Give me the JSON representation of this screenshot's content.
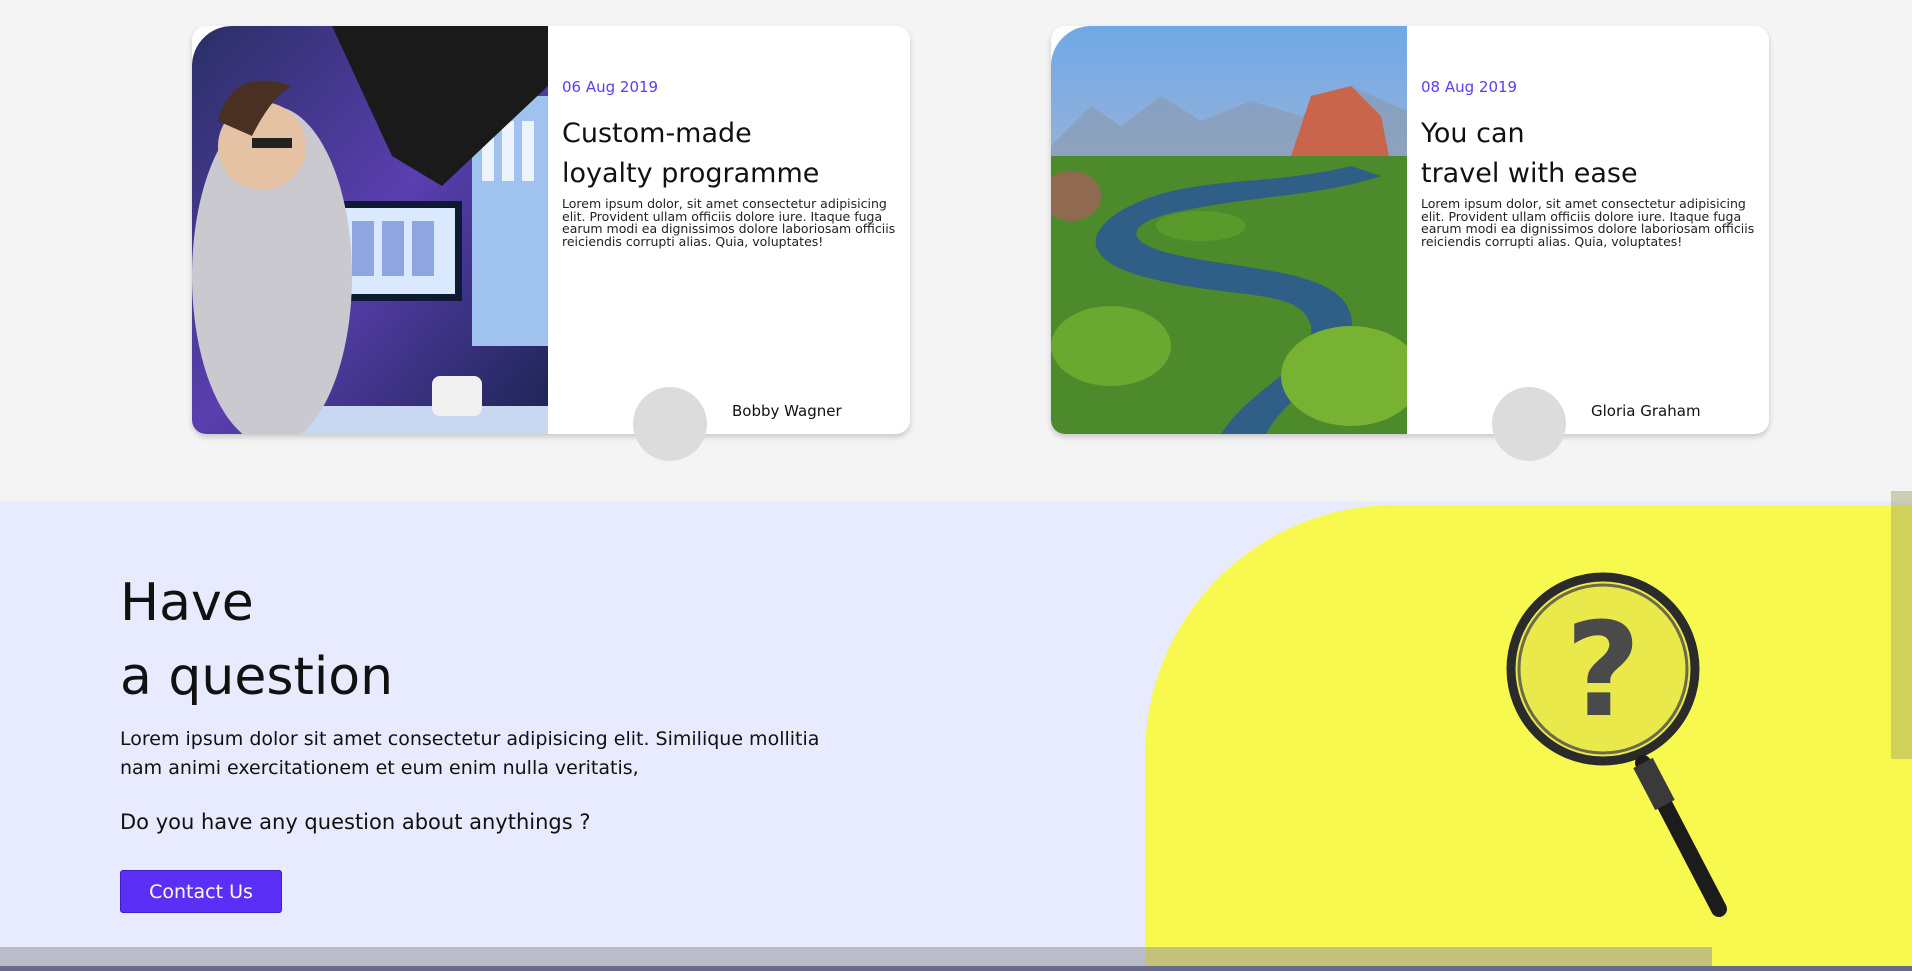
{
  "cards": [
    {
      "date": "06 Aug 2019",
      "title_line1": "Custom-made",
      "title_line2": "loyalty programme",
      "body": "Lorem ipsum dolor, sit amet consectetur adipisicing elit. Provident ullam officiis dolore iure. Itaque fuga earum modi ea dignissimos dolore laboriosam officiis reiciendis corrupti alias. Quia, voluptates!",
      "author": "Bobby Wagner"
    },
    {
      "date": "08 Aug 2019",
      "title_line1": "You can",
      "title_line2": "travel with ease",
      "body": "Lorem ipsum dolor, sit amet consectetur adipisicing elit. Provident ullam officiis dolore iure. Itaque fuga earum modi ea dignissimos dolore laboriosam officiis reiciendis corrupti alias. Quia, voluptates!",
      "author": "Gloria Graham"
    }
  ],
  "faq": {
    "heading_line1": "Have",
    "heading_line2": "a question",
    "text": "Lorem ipsum dolor sit amet consectetur adipisicing elit. Similique mollitia nam animi exercitationem et eum enim nulla veritatis,",
    "question": "Do you have any question about anythings ?",
    "button_label": "Contact Us"
  },
  "colors": {
    "accent": "#5b2ff5",
    "date": "#5b3df5",
    "faq_background": "#e8eafd",
    "faq_visual": "#f8f94f"
  }
}
